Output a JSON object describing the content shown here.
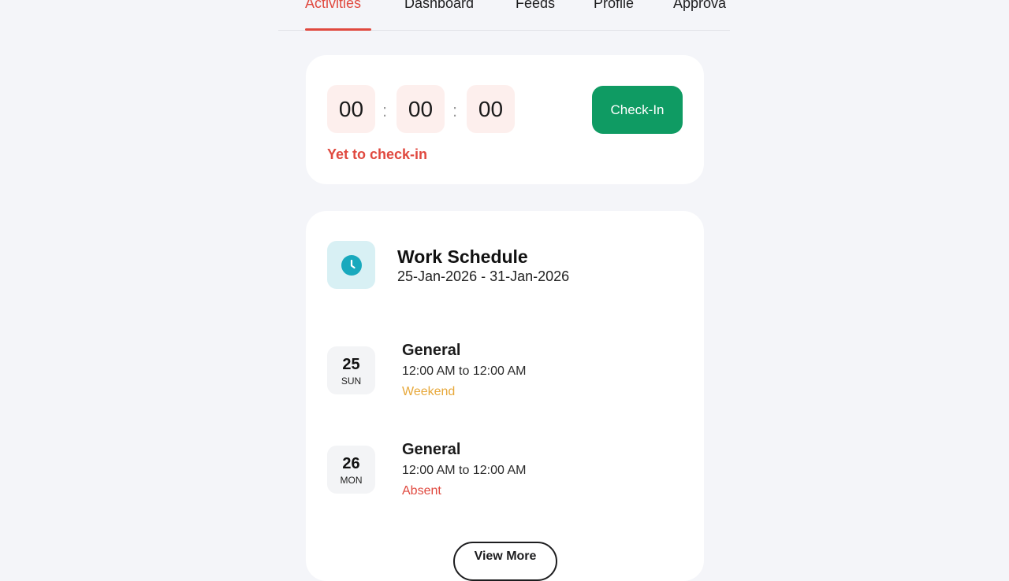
{
  "tabs": [
    {
      "label": "Activities",
      "active": true
    },
    {
      "label": "Dashboard",
      "active": false
    },
    {
      "label": "Feeds",
      "active": false
    },
    {
      "label": "Profile",
      "active": false
    },
    {
      "label": "Approva",
      "active": false
    }
  ],
  "checkin": {
    "hours": "00",
    "minutes": "00",
    "seconds": "00",
    "separator": ":",
    "status": "Yet to check-in",
    "button_label": "Check-In"
  },
  "schedule": {
    "icon": "clock-icon",
    "title": "Work Schedule",
    "range": "25-Jan-2026 - 31-Jan-2026",
    "days": [
      {
        "day": "25",
        "dow": "SUN",
        "shift": "General",
        "time": "12:00 AM to 12:00 AM",
        "status": "Weekend",
        "status_color": "#e7a83a"
      },
      {
        "day": "26",
        "dow": "MON",
        "shift": "General",
        "time": "12:00 AM to 12:00 AM",
        "status": "Absent",
        "status_color": "#e0493f"
      }
    ],
    "view_more_label": "View More"
  },
  "colors": {
    "accent": "#e0493f",
    "success": "#0f9b63",
    "clock_teal": "#19a9bd"
  }
}
